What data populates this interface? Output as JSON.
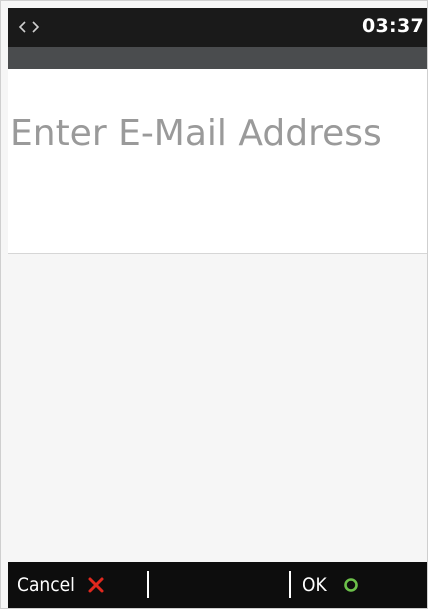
{
  "status_bar": {
    "connection_icon": "connection-arrows-icon",
    "time": "03:37"
  },
  "prompt": {
    "text": "Enter E-Mail Address"
  },
  "input": {
    "value": ""
  },
  "soft_keys": {
    "cancel_label": "Cancel",
    "cancel_icon": "close-icon",
    "ok_label": "OK",
    "ok_icon": "circle-icon"
  },
  "colors": {
    "cancel_icon": "#e0281e",
    "ok_icon": "#6cc04a",
    "prompt_text": "#9a9a9a",
    "status_bar": "#1a1a1a",
    "sub_bar": "#4a4c4e"
  }
}
